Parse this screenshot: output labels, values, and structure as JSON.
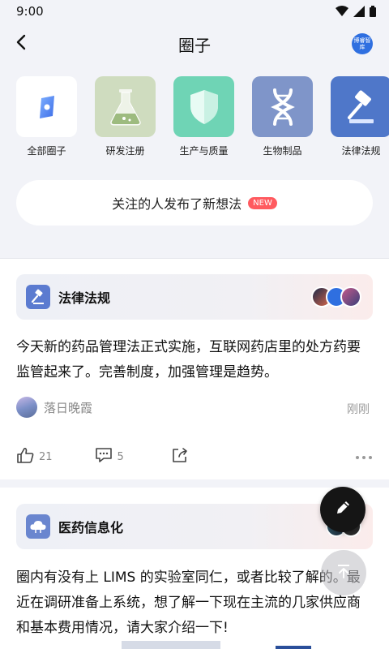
{
  "status": {
    "time": "9:00"
  },
  "header": {
    "title": "圈子",
    "logo_text": "博睿智库"
  },
  "categories": [
    {
      "label": "全部圈子",
      "icon": "circle-all-icon"
    },
    {
      "label": "研发注册",
      "icon": "flask-icon"
    },
    {
      "label": "生产与质量",
      "icon": "shield-icon"
    },
    {
      "label": "生物制品",
      "icon": "dna-icon"
    },
    {
      "label": "法律法规",
      "icon": "gavel-icon"
    }
  ],
  "notice": {
    "text": "关注的人发布了新想法",
    "badge": "NEW"
  },
  "posts": [
    {
      "circle": "法律法规",
      "circle_icon": "gavel-icon",
      "text": "今天新的药品管理法正式实施，互联网药店里的处方药要监管起来了。完善制度，加强管理是趋势。",
      "author": "落日晚霞",
      "time": "刚刚",
      "likes": "21",
      "comments": "5"
    },
    {
      "circle": "医药信息化",
      "circle_icon": "cloud-icon",
      "text": "圈内有没有上 LIMS 的实验室同仁，或者比较了解的。最近在调研准备上系统，想了解一下现在主流的几家供应商和基本费用情况，请大家介绍一下!"
    }
  ],
  "colors": {
    "accent": "#2f6fe0",
    "tile_all": "#ffffff",
    "tile_rd": "#cfdcbf",
    "tile_quality": "#6fd4b5",
    "tile_bio": "#7f95c9",
    "tile_law": "#4f77c9",
    "new_badge": "#ff5a5f"
  }
}
